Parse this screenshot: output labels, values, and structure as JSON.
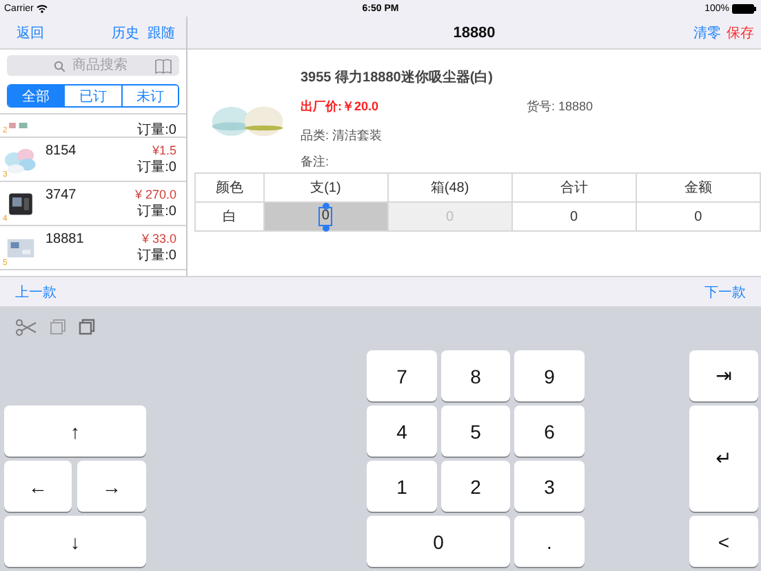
{
  "status_bar": {
    "carrier": "Carrier",
    "time": "6:50 PM",
    "battery": "100%"
  },
  "left_nav": {
    "back": "返回",
    "actions": [
      "历史",
      "跟随"
    ]
  },
  "search": {
    "placeholder": "商品搜索"
  },
  "filter_tabs": [
    {
      "label": "全部",
      "selected": true
    },
    {
      "label": "已订",
      "selected": false
    },
    {
      "label": "未订",
      "selected": false
    }
  ],
  "products": [
    {
      "index": "2",
      "qty": "订量:0"
    },
    {
      "index": "3",
      "code": "8154",
      "price": "¥1.5",
      "qty": "订量:0"
    },
    {
      "index": "4",
      "code": "3747",
      "price": "¥ 270.0",
      "qty": "订量:0"
    },
    {
      "index": "5",
      "code": "18881",
      "price": "¥ 33.0",
      "qty": "订量:0"
    }
  ],
  "detail_nav": {
    "title": "18880",
    "actions": [
      {
        "label": "清零",
        "kind": "normal"
      },
      {
        "label": "保存",
        "kind": "danger"
      }
    ]
  },
  "detail": {
    "name": "3955 得力18880迷你吸尘器(白)",
    "price": "出厂价:￥20.0",
    "sku": "货号: 18880",
    "category": "品类: 清洁套装",
    "remark": "备注:"
  },
  "table": {
    "columns": [
      "颜色",
      "支(1)",
      "箱(48)",
      "合计",
      "金额"
    ],
    "rows": [
      [
        {
          "text": "白",
          "kind": "label"
        },
        {
          "text": "0",
          "kind": "editing"
        },
        {
          "text": "0",
          "kind": "disabled"
        },
        {
          "text": "0",
          "kind": "plain"
        },
        {
          "text": "0",
          "kind": "plain"
        }
      ]
    ]
  },
  "pager": {
    "previous": "上一款",
    "next": "下一款"
  },
  "keyboard": {
    "arrow_keys": [
      "↑",
      "←",
      "→",
      "↓"
    ],
    "number_keys": [
      "7",
      "8",
      "9",
      "4",
      "5",
      "6",
      "1",
      "2",
      "3",
      "0",
      "."
    ],
    "side_keys": [
      "⇥",
      "↵",
      "<"
    ]
  }
}
